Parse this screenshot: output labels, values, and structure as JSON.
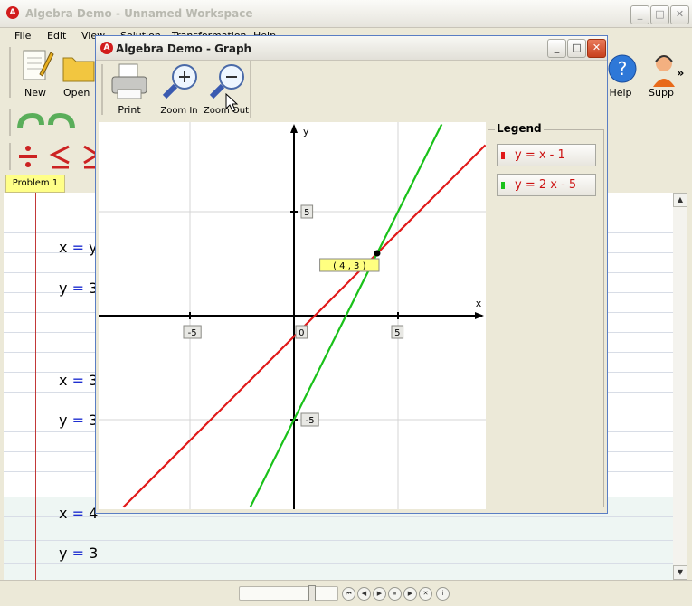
{
  "main_window": {
    "title": "Algebra Demo - Unnamed Workspace",
    "menu": [
      "File",
      "Edit",
      "View",
      "Solution",
      "Transformation",
      "Help"
    ],
    "toolbar": {
      "new_label": "New",
      "open_label": "Open",
      "help_label": "Help",
      "support_label": "Supp",
      "more_label": "»"
    },
    "tab_label": "Problem 1",
    "equation_lines": [
      {
        "lhs": "x",
        "op": "=",
        "rhs": "y"
      },
      {
        "lhs": "y",
        "op": "=",
        "rhs": "3"
      },
      {
        "lhs": "x",
        "op": "=",
        "rhs": "3"
      },
      {
        "lhs": "y",
        "op": "=",
        "rhs": "3"
      },
      {
        "lhs": "x",
        "op": "=",
        "rhs": "4"
      },
      {
        "lhs": "y",
        "op": "=",
        "rhs": "3"
      }
    ]
  },
  "graph_window": {
    "title": "Algebra Demo - Graph",
    "toolbar": {
      "print_label": "Print",
      "zoom_in_label": "Zoom In",
      "zoom_out_label": "Zoom Out"
    },
    "legend_title": "Legend"
  },
  "colors": {
    "line1": "#e01919",
    "line2": "#19c119",
    "accent_red": "#cc1111",
    "equals_blue": "#1e2fd0"
  },
  "chart_data": {
    "type": "line",
    "xlabel": "x",
    "ylabel": "y",
    "xlim": [
      -9.2,
      9.2
    ],
    "ylim": [
      -9.2,
      9.2
    ],
    "x_ticks": [
      -5,
      5
    ],
    "y_ticks": [
      5,
      -5
    ],
    "origin_label": "0",
    "grid": true,
    "series": [
      {
        "name": "y = x - 1",
        "slope": 1,
        "intercept": -1,
        "color": "#e01919"
      },
      {
        "name": "y = 2  x - 5",
        "slope": 2,
        "intercept": -5,
        "color": "#19c119"
      }
    ],
    "intersection": {
      "x": 4,
      "y": 3,
      "label": "( 4 , 3 )"
    }
  }
}
